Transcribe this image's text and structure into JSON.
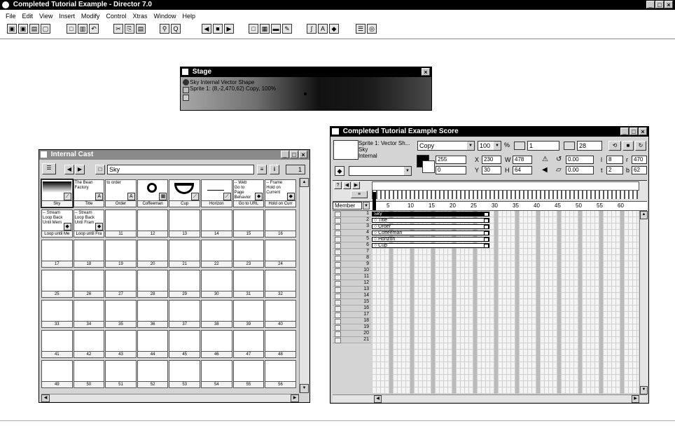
{
  "app": {
    "title": "Completed Tutorial Example - Director 7.0",
    "menu": [
      "File",
      "Edit",
      "View",
      "Insert",
      "Modify",
      "Control",
      "Xtras",
      "Window",
      "Help"
    ]
  },
  "stage": {
    "title": "Stage",
    "info_line1": "Sky Internal Vector Shape",
    "info_line2": "Sprite 1: (8,-2,470,62) Copy, 100%"
  },
  "cast": {
    "title": "Internal Cast",
    "name_field": "Sky",
    "number": "1",
    "members": [
      {
        "num": "1",
        "label": "Sky",
        "text": "",
        "icon": "vector",
        "thumb": "gradient"
      },
      {
        "num": "2",
        "label": "Title",
        "text": "The Bean\nFactory",
        "icon": "A",
        "thumb": "text"
      },
      {
        "num": "3",
        "label": "Order",
        "text": "to order",
        "icon": "A",
        "thumb": "text"
      },
      {
        "num": "4",
        "label": "Coffeeman",
        "text": "",
        "icon": "bitmap",
        "thumb": "man"
      },
      {
        "num": "5",
        "label": "Cup",
        "text": "",
        "icon": "vector",
        "thumb": "cup"
      },
      {
        "num": "6",
        "label": "Horizon",
        "text": "",
        "icon": "vector",
        "thumb": "line"
      },
      {
        "num": "7",
        "label": "Go to URL",
        "text": "-- Web\nGo to\nPage\nBehavior",
        "icon": "behavior",
        "thumb": "text"
      },
      {
        "num": "8",
        "label": "Hold on Curr",
        "text": "-- Frame\nHold on\nCurrent",
        "icon": "behavior",
        "thumb": "text"
      },
      {
        "num": "9",
        "label": "Loop until Me",
        "text": "-- Stream\nLoop Back\nUntil Mem",
        "icon": "behavior",
        "thumb": "text"
      },
      {
        "num": "10",
        "label": "Loop until Fra",
        "text": "-- Stream\nLoop Back\nUntil Fram",
        "icon": "behavior",
        "thumb": "text"
      },
      {
        "num": "11",
        "label": "11"
      },
      {
        "num": "12",
        "label": "12"
      },
      {
        "num": "13",
        "label": "13"
      },
      {
        "num": "14",
        "label": "14"
      },
      {
        "num": "15",
        "label": "15"
      },
      {
        "num": "16",
        "label": "16"
      },
      {
        "num": "17",
        "label": "17"
      },
      {
        "num": "18",
        "label": "18"
      },
      {
        "num": "19",
        "label": "19"
      },
      {
        "num": "20",
        "label": "20"
      },
      {
        "num": "21",
        "label": "21"
      },
      {
        "num": "22",
        "label": "22"
      },
      {
        "num": "23",
        "label": "23"
      },
      {
        "num": "24",
        "label": "24"
      },
      {
        "num": "25",
        "label": "25"
      },
      {
        "num": "26",
        "label": "26"
      },
      {
        "num": "27",
        "label": "27"
      },
      {
        "num": "28",
        "label": "28"
      },
      {
        "num": "29",
        "label": "29"
      },
      {
        "num": "30",
        "label": "30"
      },
      {
        "num": "31",
        "label": "31"
      },
      {
        "num": "32",
        "label": "32"
      },
      {
        "num": "33",
        "label": "33"
      },
      {
        "num": "34",
        "label": "34"
      },
      {
        "num": "35",
        "label": "35"
      },
      {
        "num": "36",
        "label": "36"
      },
      {
        "num": "37",
        "label": "37"
      },
      {
        "num": "38",
        "label": "38"
      },
      {
        "num": "39",
        "label": "39"
      },
      {
        "num": "40",
        "label": "40"
      },
      {
        "num": "41",
        "label": "41"
      },
      {
        "num": "42",
        "label": "42"
      },
      {
        "num": "43",
        "label": "43"
      },
      {
        "num": "44",
        "label": "44"
      },
      {
        "num": "45",
        "label": "45"
      },
      {
        "num": "46",
        "label": "46"
      },
      {
        "num": "47",
        "label": "47"
      },
      {
        "num": "48",
        "label": "48"
      },
      {
        "num": "49",
        "label": "49"
      },
      {
        "num": "50",
        "label": "50"
      },
      {
        "num": "51",
        "label": "51"
      },
      {
        "num": "52",
        "label": "52"
      },
      {
        "num": "53",
        "label": "53"
      },
      {
        "num": "54",
        "label": "54"
      },
      {
        "num": "55",
        "label": "55"
      },
      {
        "num": "56",
        "label": "56"
      }
    ]
  },
  "score": {
    "title": "Completed Tutorial Example Score",
    "sprite_info1": "Sprite 1: Vector Sh...",
    "sprite_info2": "Sky",
    "sprite_info3": "Internal",
    "ink": "Copy",
    "blend": "100",
    "blend_unit": "%",
    "start_frame": "1",
    "end_frame": "28",
    "fore_val": "255",
    "back_val": "0",
    "x": "230",
    "y": "30",
    "w": "478",
    "h": "64",
    "rotation": "0.00",
    "skew": "0.00",
    "l": "8",
    "t": "2",
    "r": "470",
    "b": "62",
    "lbl_x": "X",
    "lbl_y": "Y",
    "lbl_w": "W",
    "lbl_h": "H",
    "lbl_l": "l",
    "lbl_t": "t",
    "lbl_r": "r",
    "lbl_b": "b",
    "view_label": "Member",
    "frame_ticks": [
      "5",
      "10",
      "15",
      "20",
      "25",
      "30",
      "35",
      "40",
      "45",
      "50",
      "55",
      "60"
    ],
    "channels": [
      "1",
      "2",
      "3",
      "4",
      "5",
      "6",
      "7",
      "8",
      "9",
      "10",
      "11",
      "12",
      "13",
      "14",
      "15",
      "16",
      "17",
      "18",
      "19",
      "20",
      "21"
    ],
    "sprites": [
      {
        "channel": 1,
        "name": "Sky",
        "start": 1,
        "end": 28,
        "selected": true
      },
      {
        "channel": 2,
        "name": "Title",
        "start": 1,
        "end": 28,
        "selected": false
      },
      {
        "channel": 3,
        "name": "Order",
        "start": 1,
        "end": 28,
        "selected": false
      },
      {
        "channel": 4,
        "name": "Coffeeman",
        "start": 1,
        "end": 28,
        "selected": false
      },
      {
        "channel": 5,
        "name": "Horizon",
        "start": 1,
        "end": 28,
        "selected": false
      },
      {
        "channel": 6,
        "name": "Cup",
        "start": 1,
        "end": 28,
        "selected": false
      }
    ]
  }
}
